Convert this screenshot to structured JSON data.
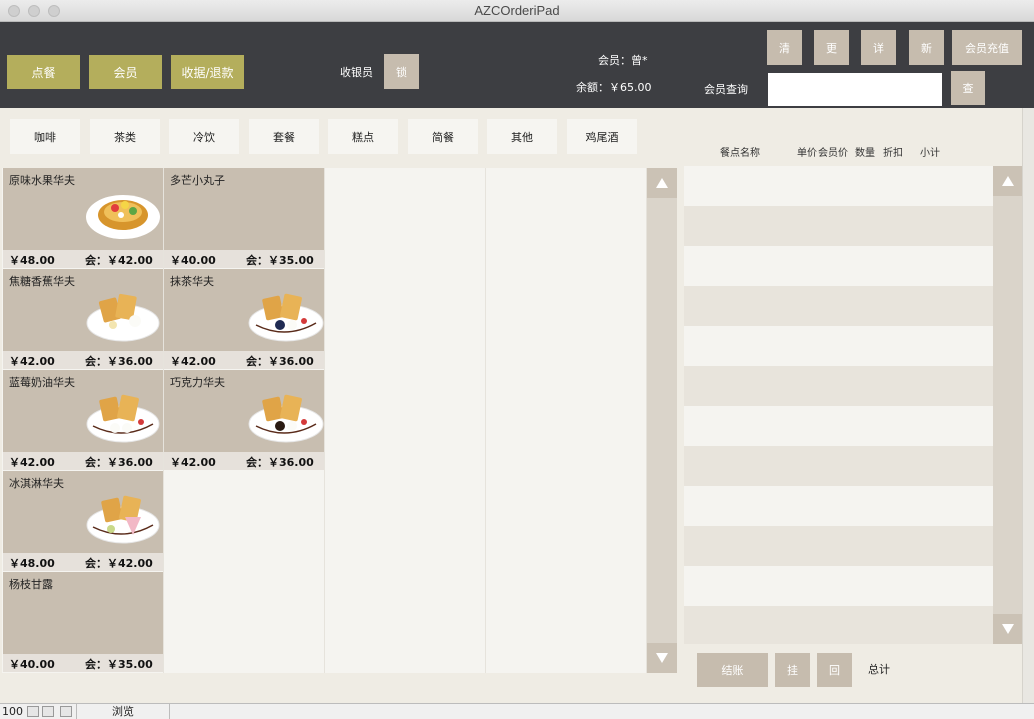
{
  "window": {
    "title": "AZCOrderiPad"
  },
  "nav": {
    "order_label": "点餐",
    "member_label": "会员",
    "receipt_label": "收据/退款"
  },
  "cashier": {
    "label": "收银员",
    "lock_label": "锁"
  },
  "member_info": {
    "member_text": "会员：曾*",
    "balance_text": "余额：￥65.00"
  },
  "member_actions": {
    "clear": "清",
    "change": "更",
    "detail": "详",
    "new": "新",
    "recharge": "会员充值",
    "query_label": "会员查询",
    "query_value": "",
    "search": "查"
  },
  "categories": [
    "咖啡",
    "茶类",
    "冷饮",
    "套餐",
    "糕点",
    "简餐",
    "其他",
    "鸡尾酒"
  ],
  "products": [
    {
      "name": "原味水果华夫",
      "price": "￥48.00",
      "member_price": "会：￥42.00",
      "image": "fruit-waffle"
    },
    {
      "name": "多芒小丸子",
      "price": "￥40.00",
      "member_price": "会：￥35.00",
      "image": ""
    },
    {
      "name": "焦糖香蕉华夫",
      "price": "￥42.00",
      "member_price": "会：￥36.00",
      "image": "waffle"
    },
    {
      "name": "抹茶华夫",
      "price": "￥42.00",
      "member_price": "会：￥36.00",
      "image": "waffle"
    },
    {
      "name": "蓝莓奶油华夫",
      "price": "￥42.00",
      "member_price": "会：￥36.00",
      "image": "waffle"
    },
    {
      "name": "巧克力华夫",
      "price": "￥42.00",
      "member_price": "会：￥36.00",
      "image": "waffle"
    },
    {
      "name": "冰淇淋华夫",
      "price": "￥48.00",
      "member_price": "会：￥42.00",
      "image": "waffle"
    },
    {
      "name": "杨枝甘露",
      "price": "￥40.00",
      "member_price": "会：￥35.00",
      "image": ""
    }
  ],
  "order": {
    "col_name": "餐点名称",
    "col_price": "单价",
    "col_member_price": "会员价",
    "col_qty": "数量",
    "col_discount": "折扣",
    "col_subtotal": "小计",
    "checkout": "结账",
    "hang": "挂",
    "recall": "回",
    "total_label": "总计"
  },
  "statusbar": {
    "zoom": "100",
    "mode": "浏览"
  },
  "colors": {
    "toolbar": "#3d3e42",
    "accent": "#b4ae5c",
    "button": "#c6bcae",
    "tile": "#c8beb0"
  }
}
